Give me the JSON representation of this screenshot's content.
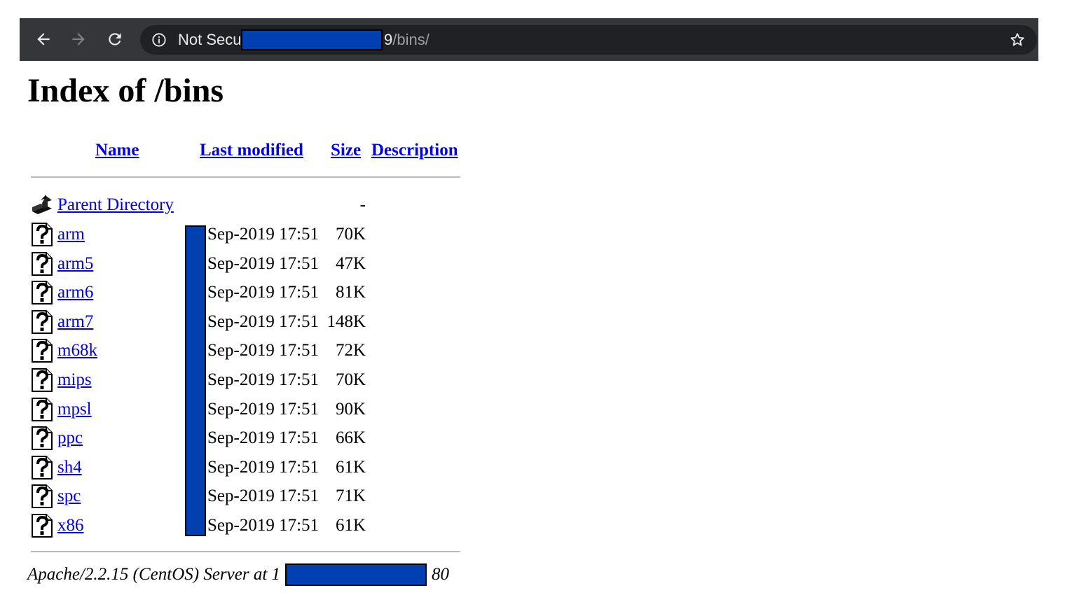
{
  "browser": {
    "back_icon": "arrow-left-icon",
    "forward_icon": "arrow-right-icon",
    "reload_icon": "reload-icon",
    "security_icon": "info-icon",
    "security_label": "Not Secu",
    "url_visible_end": "9",
    "url_path": "/bins/",
    "bookmark_icon": "star-icon",
    "bar_color": "#35363a",
    "omnibox_color": "#202124",
    "redaction_color": "#0040b0"
  },
  "page": {
    "title": "Index of /bins",
    "columns": {
      "name": "Name",
      "last_modified": "Last modified",
      "size": "Size",
      "description": "Description"
    },
    "parent": {
      "label": "Parent Directory",
      "size": "-",
      "icon": "back-folder-icon"
    },
    "files": [
      {
        "name": "arm",
        "date": "Sep-2019 17:51",
        "size": "70K",
        "icon": "unknown-file-icon"
      },
      {
        "name": "arm5",
        "date": "Sep-2019 17:51",
        "size": "47K",
        "icon": "unknown-file-icon"
      },
      {
        "name": "arm6",
        "date": "Sep-2019 17:51",
        "size": "81K",
        "icon": "unknown-file-icon"
      },
      {
        "name": "arm7",
        "date": "Sep-2019 17:51",
        "size": "148K",
        "icon": "unknown-file-icon"
      },
      {
        "name": "m68k",
        "date": "Sep-2019 17:51",
        "size": "72K",
        "icon": "unknown-file-icon"
      },
      {
        "name": "mips",
        "date": "Sep-2019 17:51",
        "size": "70K",
        "icon": "unknown-file-icon"
      },
      {
        "name": "mpsl",
        "date": "Sep-2019 17:51",
        "size": "90K",
        "icon": "unknown-file-icon"
      },
      {
        "name": "ppc",
        "date": "Sep-2019 17:51",
        "size": "66K",
        "icon": "unknown-file-icon"
      },
      {
        "name": "sh4",
        "date": "Sep-2019 17:51",
        "size": "61K",
        "icon": "unknown-file-icon"
      },
      {
        "name": "spc",
        "date": "Sep-2019 17:51",
        "size": "71K",
        "icon": "unknown-file-icon"
      },
      {
        "name": "x86",
        "date": "Sep-2019 17:51",
        "size": "61K",
        "icon": "unknown-file-icon"
      }
    ],
    "footer": {
      "text": "Apache/2.2.15 (CentOS) Server at 1",
      "port": "80"
    }
  }
}
